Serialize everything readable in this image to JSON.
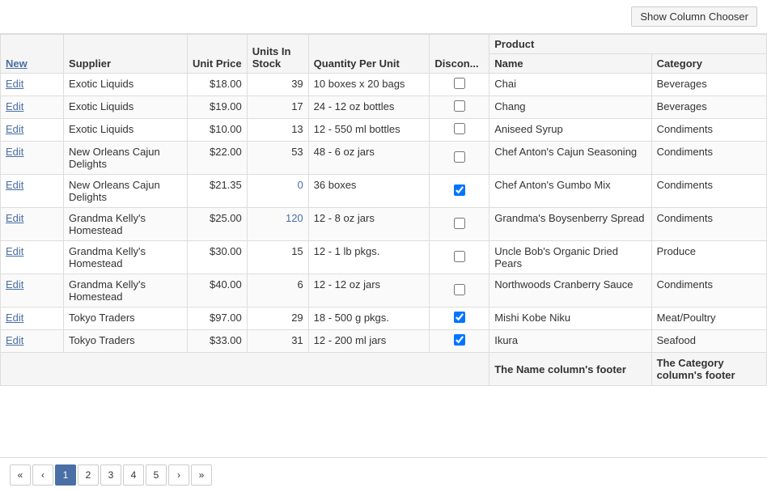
{
  "toolbar": {
    "show_column_chooser_label": "Show Column Chooser"
  },
  "grid": {
    "columns": {
      "new": "New",
      "supplier": "Supplier",
      "unit_price": "Unit Price",
      "units_in_stock": "Units In Stock",
      "qty_per_unit": "Quantity Per Unit",
      "discontinued": "Discon...",
      "product_group": "Product",
      "product_name": "Name",
      "category": "Category"
    },
    "rows": [
      {
        "edit": "Edit",
        "supplier": "Exotic Liquids",
        "unit_price": "$18.00",
        "units_in_stock": 39,
        "qty_per_unit": "10 boxes x 20 bags",
        "discontinued": false,
        "product_name": "Chai",
        "category": "Beverages"
      },
      {
        "edit": "Edit",
        "supplier": "Exotic Liquids",
        "unit_price": "$19.00",
        "units_in_stock": 17,
        "qty_per_unit": "24 - 12 oz bottles",
        "discontinued": false,
        "product_name": "Chang",
        "category": "Beverages"
      },
      {
        "edit": "Edit",
        "supplier": "Exotic Liquids",
        "unit_price": "$10.00",
        "units_in_stock": 13,
        "qty_per_unit": "12 - 550 ml bottles",
        "discontinued": false,
        "product_name": "Aniseed Syrup",
        "category": "Condiments"
      },
      {
        "edit": "Edit",
        "supplier": "New Orleans Cajun Delights",
        "unit_price": "$22.00",
        "units_in_stock": 53,
        "qty_per_unit": "48 - 6 oz jars",
        "discontinued": false,
        "product_name": "Chef Anton's Cajun Seasoning",
        "category": "Condiments"
      },
      {
        "edit": "Edit",
        "supplier": "New Orleans Cajun Delights",
        "unit_price": "$21.35",
        "units_in_stock": 0,
        "qty_per_unit": "36 boxes",
        "discontinued": true,
        "product_name": "Chef Anton's Gumbo Mix",
        "category": "Condiments"
      },
      {
        "edit": "Edit",
        "supplier": "Grandma Kelly's Homestead",
        "unit_price": "$25.00",
        "units_in_stock": 120,
        "qty_per_unit": "12 - 8 oz jars",
        "discontinued": false,
        "product_name": "Grandma's Boysenberry Spread",
        "category": "Condiments"
      },
      {
        "edit": "Edit",
        "supplier": "Grandma Kelly's Homestead",
        "unit_price": "$30.00",
        "units_in_stock": 15,
        "qty_per_unit": "12 - 1 lb pkgs.",
        "discontinued": false,
        "product_name": "Uncle Bob's Organic Dried Pears",
        "category": "Produce"
      },
      {
        "edit": "Edit",
        "supplier": "Grandma Kelly's Homestead",
        "unit_price": "$40.00",
        "units_in_stock": 6,
        "qty_per_unit": "12 - 12 oz jars",
        "discontinued": false,
        "product_name": "Northwoods Cranberry Sauce",
        "category": "Condiments"
      },
      {
        "edit": "Edit",
        "supplier": "Tokyo Traders",
        "unit_price": "$97.00",
        "units_in_stock": 29,
        "qty_per_unit": "18 - 500 g pkgs.",
        "discontinued": true,
        "product_name": "Mishi Kobe Niku",
        "category": "Meat/Poultry"
      },
      {
        "edit": "Edit",
        "supplier": "Tokyo Traders",
        "unit_price": "$33.00",
        "units_in_stock": 31,
        "qty_per_unit": "12 - 200 ml jars",
        "discontinued": true,
        "product_name": "Ikura",
        "category": "Seafood"
      }
    ],
    "footer": {
      "product_name": "The Name column's footer",
      "category": "The Category column's footer"
    }
  },
  "pagination": {
    "first": "«",
    "prev": "‹",
    "pages": [
      "1",
      "2",
      "3",
      "4",
      "5"
    ],
    "next": "›",
    "last": "»",
    "current": 0
  }
}
